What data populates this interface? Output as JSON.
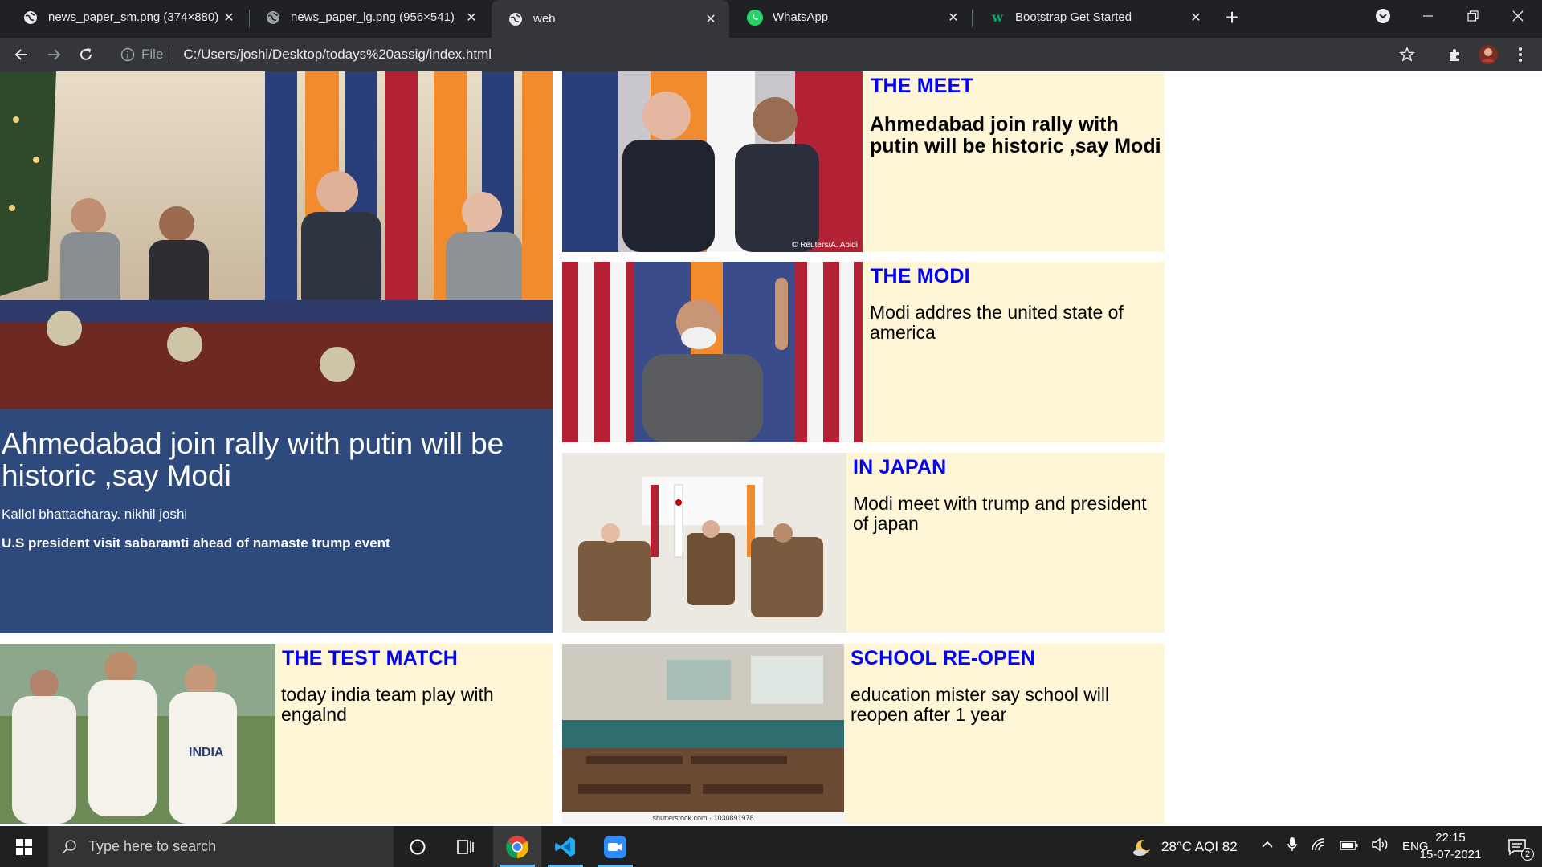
{
  "browser": {
    "tabs": [
      {
        "title": "news_paper_sm.png (374×880)",
        "icon": "globe-icon"
      },
      {
        "title": "news_paper_lg.png (956×541)",
        "icon": "globe-icon"
      },
      {
        "title": "web",
        "icon": "globe-icon",
        "active": true
      },
      {
        "title": "WhatsApp",
        "icon": "whatsapp-icon"
      },
      {
        "title": "Bootstrap Get Started",
        "icon": "w3schools-icon"
      }
    ],
    "address": {
      "scheme_label": "File",
      "url": "C:/Users/joshi/Desktop/todays%20assig/index.html"
    }
  },
  "page": {
    "hero": {
      "headline": "Ahmedabad join rally with putin will be historic ,say Modi",
      "byline": "Kallol bhattacharay. nikhil joshi",
      "subhead": "U.S president visit sabaramti ahead of namaste trump event",
      "bg_color": "#2e4a7d"
    },
    "cards": [
      {
        "heading": "THE MEET",
        "body": "Ahmedabad join rally with putin will be historic ,say Modi",
        "photo_caption": "© Reuters/A. Abidi"
      },
      {
        "heading": "THE MODI",
        "body": "Modi addres the united state of america"
      },
      {
        "heading": "IN JAPAN",
        "body": "Modi meet with trump and president of japan"
      },
      {
        "heading": "THE TEST MATCH",
        "body": "today india team play with engalnd",
        "photo_text": "INDIA"
      },
      {
        "heading": "SCHOOL RE-OPEN",
        "body": "education mister say school will reopen after 1 year",
        "photo_caption": "shutterstock.com · 1030891978"
      }
    ],
    "colors": {
      "card_bg": "#fff6d8",
      "heading": "#0000ff"
    }
  },
  "taskbar": {
    "search_placeholder": "Type here to search",
    "weather": "28°C  AQI 82",
    "language": "ENG",
    "time": "22:15",
    "date": "15-07-2021",
    "notification_count": "2"
  }
}
